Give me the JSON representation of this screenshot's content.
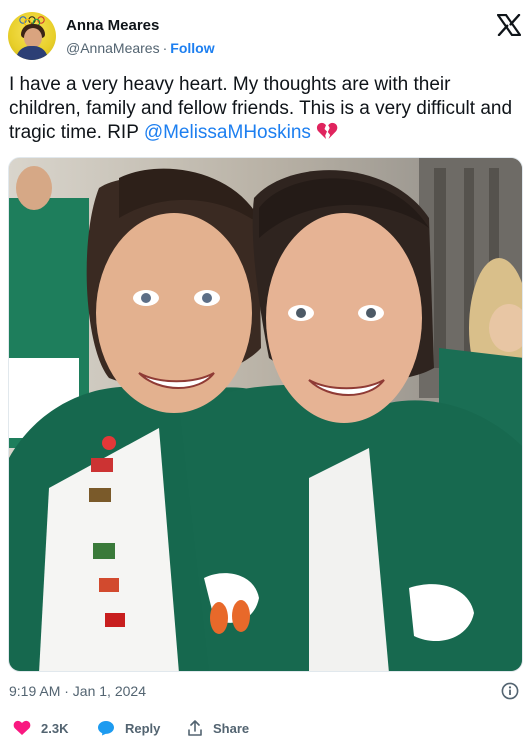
{
  "author": {
    "name": "Anna Meares",
    "handle": "@AnnaMeares",
    "separator": "·",
    "follow_label": "Follow"
  },
  "tweet": {
    "text": "I have a very heavy heart. My thoughts are with their children, family and fellow friends. This is a very difficult and tragic time. RIP ",
    "mention": "@MelissaMHoskins",
    "emoji": "broken-heart-icon"
  },
  "photo": {
    "alt": "Two smiling women in green team jackets"
  },
  "meta": {
    "timestamp": "9:19 AM · Jan 1, 2024"
  },
  "actions": {
    "like_count": "2.3K",
    "reply_label": "Reply",
    "share_label": "Share"
  },
  "colors": {
    "accent": "#1d7ff0",
    "like": "#f91880",
    "text": "#0f1419",
    "muted": "#536471"
  }
}
